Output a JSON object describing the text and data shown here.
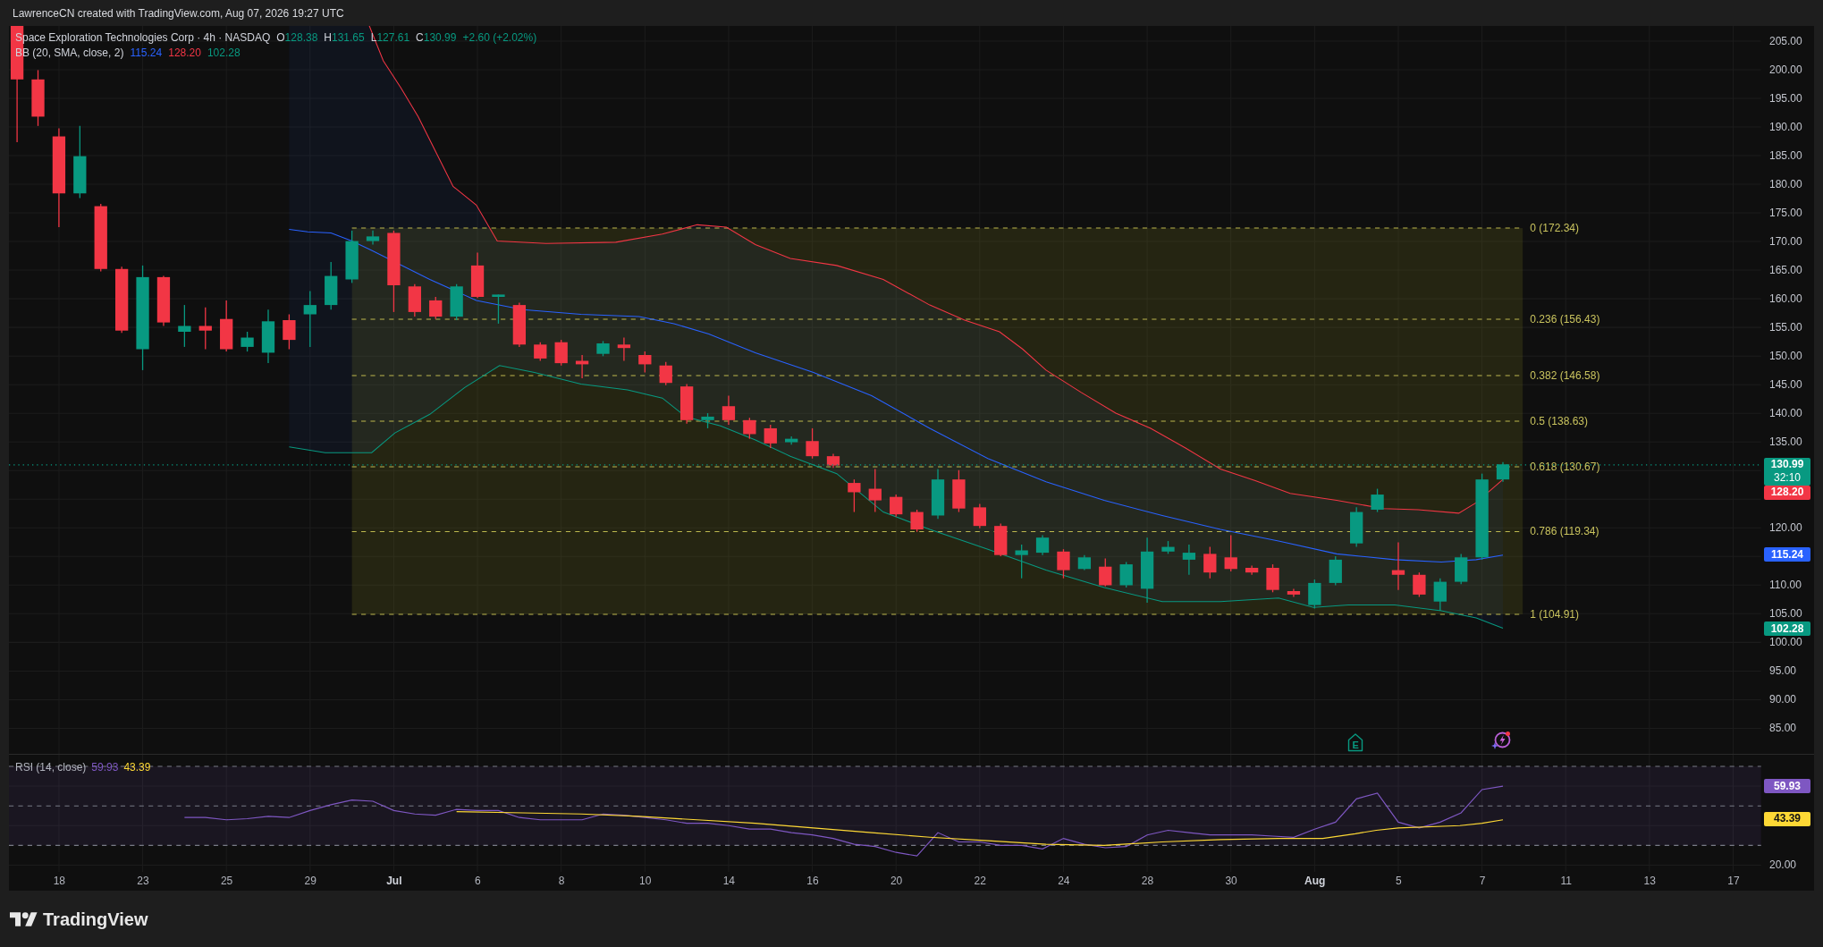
{
  "header": {
    "text": "LawrenceCN created with TradingView.com, Aug 07, 2026 19:27 UTC"
  },
  "legend": {
    "symbol": "Space Exploration Technologies Corp · 4h · NASDAQ",
    "ohlc": [
      {
        "key": "O",
        "value": "128.38"
      },
      {
        "key": "H",
        "value": "131.65"
      },
      {
        "key": "L",
        "value": "127.61"
      },
      {
        "key": "C",
        "value": "130.99"
      }
    ],
    "change": "+2.60 (+2.02%)",
    "indicator": {
      "name": "BB (20, SMA, close, 2)",
      "values": [
        {
          "value": "115.24",
          "color": "#2962ff"
        },
        {
          "value": "128.20",
          "color": "#f23645"
        },
        {
          "value": "102.28",
          "color": "#089981"
        }
      ]
    }
  },
  "fibonacci": {
    "levels": [
      "0 (172.34)",
      "0.236 (156.43)",
      "0.382 (146.58)",
      "0.5 (138.63)",
      "0.618 (130.67)",
      "0.786 (119.34)",
      "1 (104.91)"
    ]
  },
  "earnings_marker": {
    "label": "E"
  },
  "price_axis": {
    "labels": [
      "205.00",
      "200.00",
      "195.00",
      "190.00",
      "185.00",
      "180.00",
      "175.00",
      "170.00",
      "165.00",
      "160.00",
      "155.00",
      "150.00",
      "145.00",
      "140.00",
      "135.00",
      "120.00",
      "110.00",
      "105.00",
      "100.00",
      "95.00",
      "90.00",
      "85.00"
    ],
    "badges": [
      {
        "value": "130.99",
        "countdown": "32:10",
        "color": "#089981"
      },
      {
        "value": "128.20",
        "color": "#f23645"
      },
      {
        "value": "115.24",
        "color": "#2962ff"
      },
      {
        "value": "102.28",
        "color": "#089981"
      }
    ]
  },
  "rsi": {
    "name": "RSI (14, close)",
    "values": [
      {
        "value": "59.93",
        "color": "#7e57c2"
      },
      {
        "value": "43.39",
        "color": "#fdd835"
      }
    ],
    "axis_labels": [
      "20.00"
    ],
    "badges": [
      {
        "value": "59.93",
        "color": "#7e57c2"
      },
      {
        "value": "43.39",
        "color": "#fdd835"
      }
    ]
  },
  "time_axis": {
    "labels": [
      {
        "text": "18",
        "kind": "day"
      },
      {
        "text": "23",
        "kind": "day"
      },
      {
        "text": "25",
        "kind": "day"
      },
      {
        "text": "29",
        "kind": "day"
      },
      {
        "text": "Jul",
        "kind": "month"
      },
      {
        "text": "6",
        "kind": "day"
      },
      {
        "text": "8",
        "kind": "day"
      },
      {
        "text": "10",
        "kind": "day"
      },
      {
        "text": "14",
        "kind": "day"
      },
      {
        "text": "16",
        "kind": "day"
      },
      {
        "text": "20",
        "kind": "day"
      },
      {
        "text": "22",
        "kind": "day"
      },
      {
        "text": "24",
        "kind": "day"
      },
      {
        "text": "28",
        "kind": "day"
      },
      {
        "text": "30",
        "kind": "day"
      },
      {
        "text": "Aug",
        "kind": "month"
      },
      {
        "text": "5",
        "kind": "day"
      },
      {
        "text": "7",
        "kind": "day"
      },
      {
        "text": "11",
        "kind": "day"
      },
      {
        "text": "13",
        "kind": "day"
      },
      {
        "text": "17",
        "kind": "day"
      }
    ]
  },
  "footer": {
    "brand": "TradingView"
  }
}
